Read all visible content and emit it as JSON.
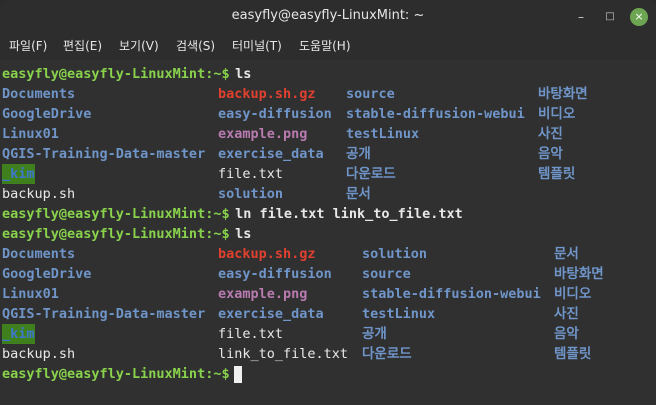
{
  "window": {
    "title": "easyfly@easyfly-LinuxMint: ~",
    "minimize_glyph": "–",
    "maximize_glyph": "□",
    "close_glyph": "×"
  },
  "menu": {
    "file": "파일(F)",
    "edit": "편집(E)",
    "view": "보기(V)",
    "search": "검색(S)",
    "terminal": "터미널(T)",
    "help": "도움말(H)"
  },
  "terminal": {
    "prompt": "easyfly@easyfly-LinuxMint:~$",
    "cmd1": " ls",
    "cmd2": " ln file.txt link_to_file.txt",
    "cmd3": " ls",
    "cmd4": " ",
    "ls1": {
      "col1": [
        "Documents",
        "GoogleDrive",
        "Linux01",
        "QGIS-Training-Data-master",
        "_kim",
        "backup.sh"
      ],
      "col2": [
        "backup.sh.gz",
        "easy-diffusion",
        "example.png",
        "exercise_data",
        "file.txt",
        "solution"
      ],
      "col3": [
        "source",
        "stable-diffusion-webui",
        "testLinux",
        "공개",
        "다운로드",
        "문서"
      ],
      "col4": [
        "바탕화면",
        "비디오",
        "사진",
        "음악",
        "템플릿",
        ""
      ]
    },
    "ls2": {
      "col1": [
        "Documents",
        "GoogleDrive",
        "Linux01",
        "QGIS-Training-Data-master",
        "_kim",
        "backup.sh"
      ],
      "col2": [
        "backup.sh.gz",
        "easy-diffusion",
        "example.png",
        "exercise_data",
        "file.txt",
        "link_to_file.txt"
      ],
      "col3": [
        "solution",
        "source",
        "stable-diffusion-webui",
        "testLinux",
        "공개",
        "다운로드"
      ],
      "col4": [
        "문서",
        "바탕화면",
        "비디오",
        "사진",
        "음악",
        "템플릿"
      ]
    },
    "colors": {
      "prompt": "#88d24c",
      "directory": "#6f95c9",
      "archive": "#e0412f",
      "image": "#b77bb0",
      "file": "#e8e8e8",
      "highlight_bg": "#3f7f1e"
    }
  }
}
